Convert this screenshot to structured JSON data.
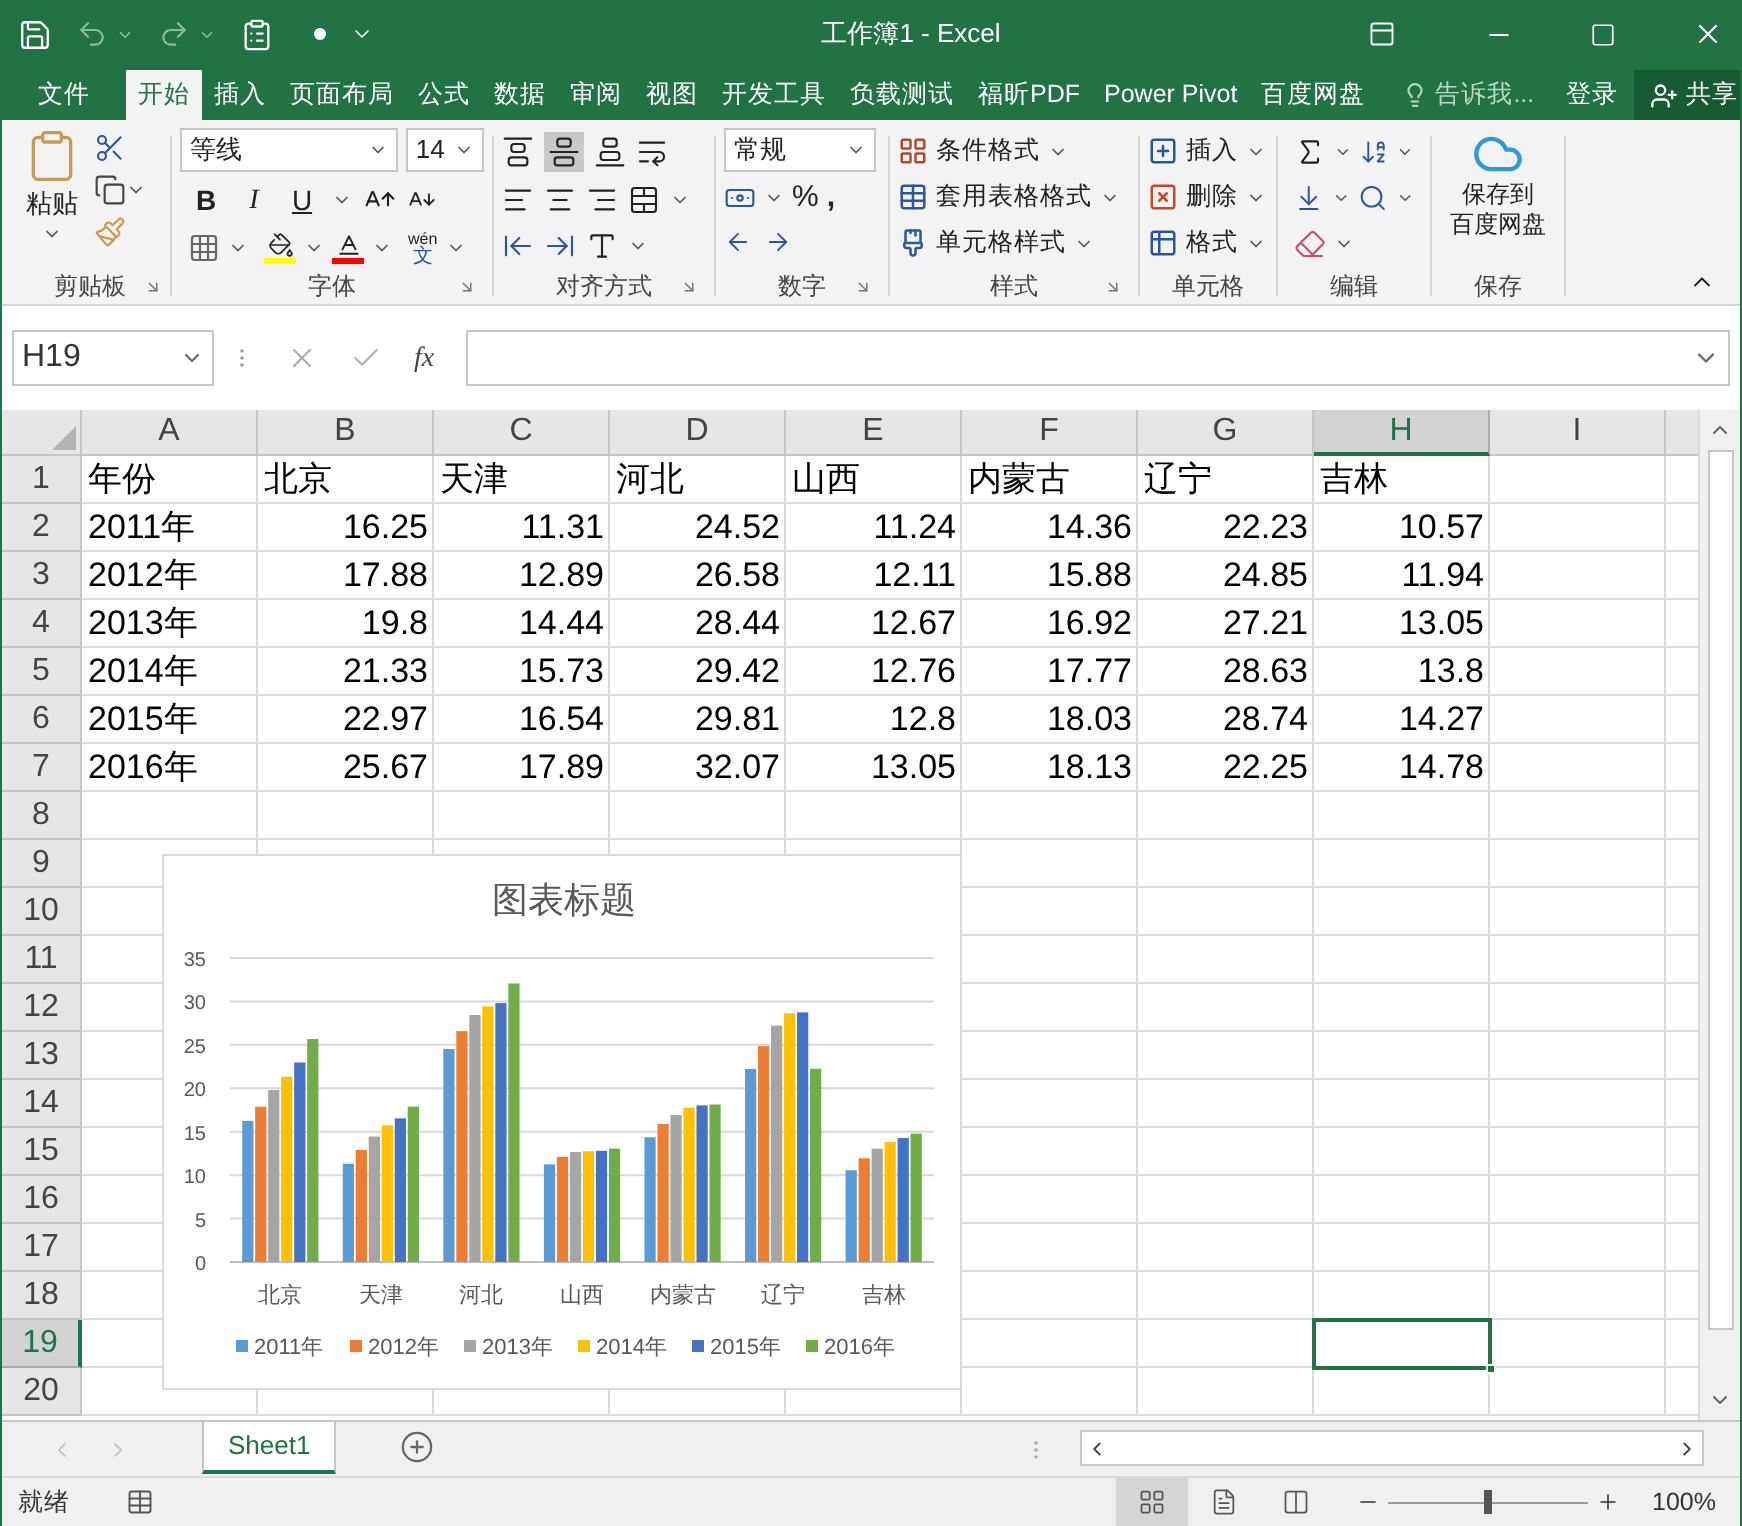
{
  "title_bar": {
    "title": "工作簿1 - Excel"
  },
  "menu_tabs": [
    {
      "label": "文件",
      "selected": false
    },
    {
      "label": "开始",
      "selected": true
    },
    {
      "label": "插入",
      "selected": false
    },
    {
      "label": "页面布局",
      "selected": false
    },
    {
      "label": "公式",
      "selected": false
    },
    {
      "label": "数据",
      "selected": false
    },
    {
      "label": "审阅",
      "selected": false
    },
    {
      "label": "视图",
      "selected": false
    },
    {
      "label": "开发工具",
      "selected": false
    },
    {
      "label": "负载测试",
      "selected": false
    },
    {
      "label": "福昕PDF",
      "selected": false
    },
    {
      "label": "Power Pivot",
      "selected": false
    },
    {
      "label": "百度网盘",
      "selected": false
    }
  ],
  "tell_me": {
    "placeholder": "告诉我..."
  },
  "sign_in": "登录",
  "share": "共享",
  "ribbon": {
    "clipboard": {
      "paste": "粘贴",
      "label": "剪贴板"
    },
    "font": {
      "font_name": "等线",
      "font_size": "14",
      "style_buttons": [
        "B",
        "I",
        "U"
      ],
      "phonetic_top": "wén",
      "phonetic_bottom": "文",
      "label": "字体"
    },
    "alignment": {
      "label": "对齐方式"
    },
    "number": {
      "format": "常规",
      "percent": "%",
      "comma": ",",
      "label": "数字"
    },
    "styles": {
      "buttons": [
        "条件格式",
        "套用表格格式",
        "单元格样式"
      ],
      "label": "样式"
    },
    "cells": {
      "buttons": [
        "插入",
        "删除",
        "格式"
      ],
      "label": "单元格"
    },
    "editing": {
      "label": "编辑"
    },
    "save": {
      "button_lines": [
        "保存到",
        "百度网盘"
      ],
      "label": "保存"
    }
  },
  "formula_bar": {
    "name_box": "H19",
    "fx": "fx"
  },
  "columns": [
    {
      "label": "A",
      "selected": false
    },
    {
      "label": "B",
      "selected": false
    },
    {
      "label": "C",
      "selected": false
    },
    {
      "label": "D",
      "selected": false
    },
    {
      "label": "E",
      "selected": false
    },
    {
      "label": "F",
      "selected": false
    },
    {
      "label": "G",
      "selected": false
    },
    {
      "label": "H",
      "selected": true
    },
    {
      "label": "I",
      "selected": false
    }
  ],
  "rows": [
    {
      "number": "1",
      "selected": false,
      "kind": "header",
      "cells": [
        "年份",
        "北京",
        "天津",
        "河北",
        "山西",
        "内蒙古",
        "辽宁",
        "吉林"
      ]
    },
    {
      "number": "2",
      "selected": false,
      "kind": "data",
      "cells": [
        "2011年",
        "16.25",
        "11.31",
        "24.52",
        "11.24",
        "14.36",
        "22.23",
        "10.57"
      ]
    },
    {
      "number": "3",
      "selected": false,
      "kind": "data",
      "cells": [
        "2012年",
        "17.88",
        "12.89",
        "26.58",
        "12.11",
        "15.88",
        "24.85",
        "11.94"
      ]
    },
    {
      "number": "4",
      "selected": false,
      "kind": "data",
      "cells": [
        "2013年",
        "19.8",
        "14.44",
        "28.44",
        "12.67",
        "16.92",
        "27.21",
        "13.05"
      ]
    },
    {
      "number": "5",
      "selected": false,
      "kind": "data",
      "cells": [
        "2014年",
        "21.33",
        "15.73",
        "29.42",
        "12.76",
        "17.77",
        "28.63",
        "13.8"
      ]
    },
    {
      "number": "6",
      "selected": false,
      "kind": "data",
      "cells": [
        "2015年",
        "22.97",
        "16.54",
        "29.81",
        "12.8",
        "18.03",
        "28.74",
        "14.27"
      ]
    },
    {
      "number": "7",
      "selected": false,
      "kind": "data",
      "cells": [
        "2016年",
        "25.67",
        "17.89",
        "32.07",
        "13.05",
        "18.13",
        "22.25",
        "14.78"
      ]
    },
    {
      "number": "8",
      "selected": false
    },
    {
      "number": "9",
      "selected": false
    },
    {
      "number": "10",
      "selected": false
    },
    {
      "number": "11",
      "selected": false
    },
    {
      "number": "12",
      "selected": false
    },
    {
      "number": "13",
      "selected": false
    },
    {
      "number": "14",
      "selected": false
    },
    {
      "number": "15",
      "selected": false
    },
    {
      "number": "16",
      "selected": false
    },
    {
      "number": "17",
      "selected": false
    },
    {
      "number": "18",
      "selected": false
    },
    {
      "number": "19",
      "selected": true
    },
    {
      "number": "20",
      "selected": false
    }
  ],
  "chart": {
    "chart_data": {
      "type": "bar",
      "title": "图表标题",
      "grid": true,
      "legend": true,
      "categories": [
        "北京",
        "天津",
        "河北",
        "山西",
        "内蒙古",
        "辽宁",
        "吉林"
      ],
      "ylim": [
        0,
        35
      ],
      "yticks": [
        0,
        5,
        10,
        15,
        20,
        25,
        30,
        35
      ],
      "series": [
        {
          "name": "2011年",
          "color": "#5b9bd5",
          "values": [
            16.25,
            11.31,
            24.52,
            11.24,
            14.36,
            22.23,
            10.57
          ]
        },
        {
          "name": "2012年",
          "color": "#ed7d31",
          "values": [
            17.88,
            12.89,
            26.58,
            12.11,
            15.88,
            24.85,
            11.94
          ]
        },
        {
          "name": "2013年",
          "color": "#a5a5a5",
          "values": [
            19.8,
            14.44,
            28.44,
            12.67,
            16.92,
            27.21,
            13.05
          ]
        },
        {
          "name": "2014年",
          "color": "#ffc000",
          "values": [
            21.33,
            15.73,
            29.42,
            12.76,
            17.77,
            28.63,
            13.8
          ]
        },
        {
          "name": "2015年",
          "color": "#4472c4",
          "values": [
            22.97,
            16.54,
            29.81,
            12.8,
            18.03,
            28.74,
            14.27
          ]
        },
        {
          "name": "2016年",
          "color": "#70ad47",
          "values": [
            25.67,
            17.89,
            32.07,
            13.05,
            18.13,
            22.25,
            14.78
          ]
        }
      ]
    }
  },
  "sheet_tabs": [
    {
      "label": "Sheet1",
      "selected": true
    }
  ],
  "status_bar": {
    "status": "就绪",
    "views": [
      {
        "kind": "normal",
        "selected": true
      },
      {
        "kind": "page_layout",
        "selected": false
      },
      {
        "kind": "page_break",
        "selected": false
      }
    ],
    "zoom": {
      "level": 0.5,
      "reading": "100%"
    }
  }
}
